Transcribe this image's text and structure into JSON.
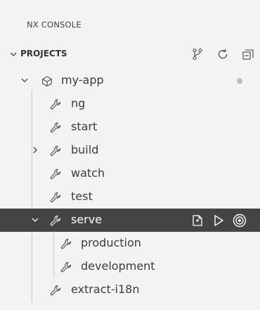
{
  "panel": {
    "title": "NX CONSOLE"
  },
  "section": {
    "title": "PROJECTS"
  },
  "project": {
    "name": "my-app"
  },
  "targets": [
    {
      "label": "ng"
    },
    {
      "label": "start"
    },
    {
      "label": "build"
    },
    {
      "label": "watch"
    },
    {
      "label": "test"
    },
    {
      "label": "serve"
    },
    {
      "label": "production"
    },
    {
      "label": "development"
    },
    {
      "label": "extract-i18n"
    }
  ],
  "colors": {
    "background": "#f3f3f3",
    "selected_background": "#444444",
    "selected_foreground": "#ffffff",
    "tree_guide": "#c8c8c8",
    "status_dot": "#bdbdbd"
  },
  "icons": {
    "section_actions": [
      "git-branch-icon",
      "refresh-icon",
      "collapse-all-icon"
    ],
    "project": "project-package-icon",
    "target": "wrench-icon",
    "serve_actions": [
      "reveal-in-file-icon",
      "run-play-icon",
      "target-circle-icon"
    ]
  }
}
